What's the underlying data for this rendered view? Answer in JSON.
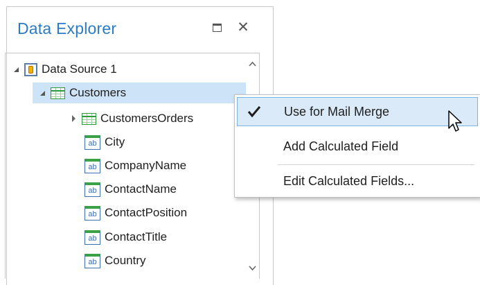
{
  "panel": {
    "title": "Data Explorer",
    "maximize_icon": "maximize-icon",
    "close_icon": "close-icon"
  },
  "tree": {
    "root": {
      "label": "Data Source 1",
      "icon": "datasource-icon",
      "expanded": true
    },
    "table": {
      "label": "Customers",
      "icon": "table-icon",
      "expanded": true,
      "selected": true
    },
    "children": [
      {
        "label": "CustomersOrders",
        "icon": "table-icon",
        "expandable": true
      },
      {
        "label": "City",
        "icon": "field-icon"
      },
      {
        "label": "CompanyName",
        "icon": "field-icon"
      },
      {
        "label": "ContactName",
        "icon": "field-icon"
      },
      {
        "label": "ContactPosition",
        "icon": "field-icon"
      },
      {
        "label": "ContactTitle",
        "icon": "field-icon"
      },
      {
        "label": "Country",
        "icon": "field-icon"
      }
    ],
    "field_icon_text": "ab"
  },
  "context_menu": {
    "items": [
      {
        "label": "Use for Mail Merge",
        "checked": true,
        "highlighted": true
      },
      {
        "label": "Add Calculated Field",
        "checked": false
      },
      {
        "label": "Edit Calculated Fields...",
        "checked": false
      }
    ]
  },
  "colors": {
    "title": "#2b7bc7",
    "selection": "#cde3f7",
    "menu_highlight": "#dbeaf8"
  }
}
